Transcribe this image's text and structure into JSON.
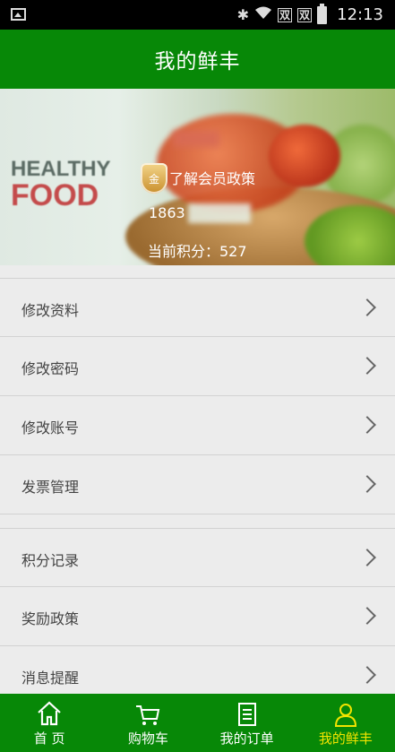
{
  "status_bar": {
    "time": "12:13",
    "sim1": "双",
    "sim2": "双"
  },
  "header": {
    "title": "我的鲜丰"
  },
  "banner": {
    "healthy_text": "HEALTHY",
    "food_text": "FOOD",
    "badge_char": "金",
    "member_policy_link": "了解会员政策",
    "phone": "1863",
    "points_text": "当前积分：527"
  },
  "menu_group1": [
    {
      "label": "修改资料"
    },
    {
      "label": "修改密码"
    },
    {
      "label": "修改账号"
    },
    {
      "label": "发票管理"
    }
  ],
  "menu_group2": [
    {
      "label": "积分记录"
    },
    {
      "label": "奖励政策"
    },
    {
      "label": "消息提醒"
    }
  ],
  "bottom_nav": [
    {
      "label": "首 页",
      "icon": "home-icon"
    },
    {
      "label": "购物车",
      "icon": "cart-icon"
    },
    {
      "label": "我的订单",
      "icon": "order-icon"
    },
    {
      "label": "我的鲜丰",
      "icon": "user-icon",
      "active": true
    }
  ],
  "colors": {
    "brand_green": "#078807",
    "active_tab": "#f2e400"
  }
}
